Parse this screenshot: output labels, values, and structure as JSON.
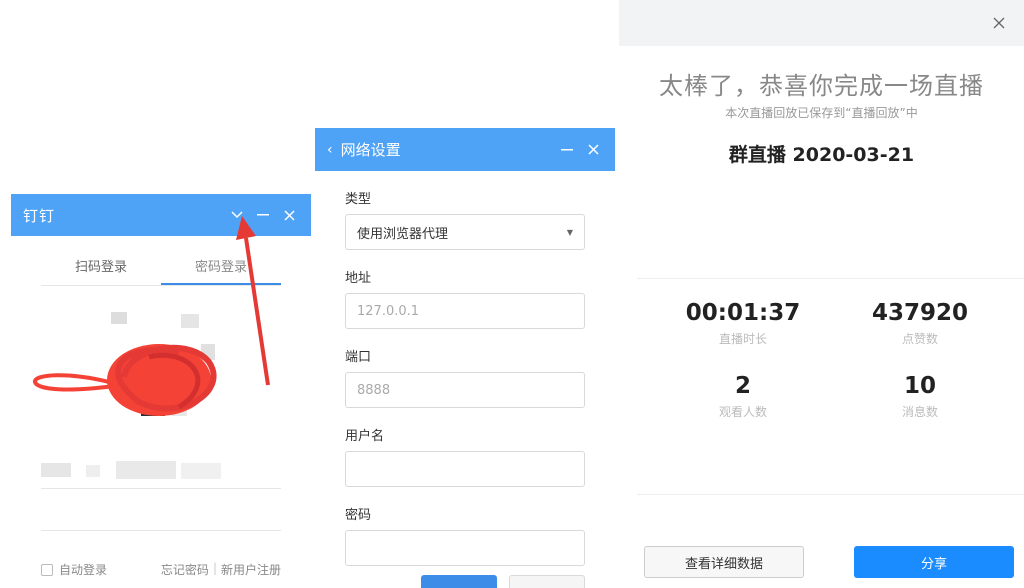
{
  "login": {
    "app_name": "钉钉",
    "tabs": [
      "扫码登录",
      "密码登录"
    ],
    "active_tab": 1,
    "auto_login": "自动登录",
    "forgot_password": "忘记密码",
    "register": "新用户注册",
    "accent": "#4fa3f7"
  },
  "network": {
    "back": "‹",
    "title": "网络设置",
    "fields": [
      {
        "label": "类型",
        "value": "使用浏览器代理",
        "kind": "select"
      },
      {
        "label": "地址",
        "value": "127.0.0.1",
        "kind": "placeholder"
      },
      {
        "label": "端口",
        "value": "8888",
        "kind": "placeholder"
      },
      {
        "label": "用户名",
        "value": "",
        "kind": "input"
      },
      {
        "label": "密码",
        "value": "",
        "kind": "input"
      }
    ]
  },
  "live": {
    "headline": "太棒了，恭喜你完成一场直播",
    "subtitle": "本次直播回放已保存到“直播回放”中",
    "group_title": "群直播 2020-03-21",
    "stats": [
      {
        "value": "00:01:37",
        "label": "直播时长"
      },
      {
        "value": "437920",
        "label": "点赞数"
      },
      {
        "value": "2",
        "label": "观看人数"
      },
      {
        "value": "10",
        "label": "消息数"
      }
    ],
    "detail_button": "查看详细数据",
    "share_button": "分享",
    "share_color": "#1a8cff"
  },
  "icons": {
    "chevron": "chevron-down-icon",
    "minimize": "minimize-icon",
    "close": "close-icon",
    "caret": "caret-down-icon"
  }
}
